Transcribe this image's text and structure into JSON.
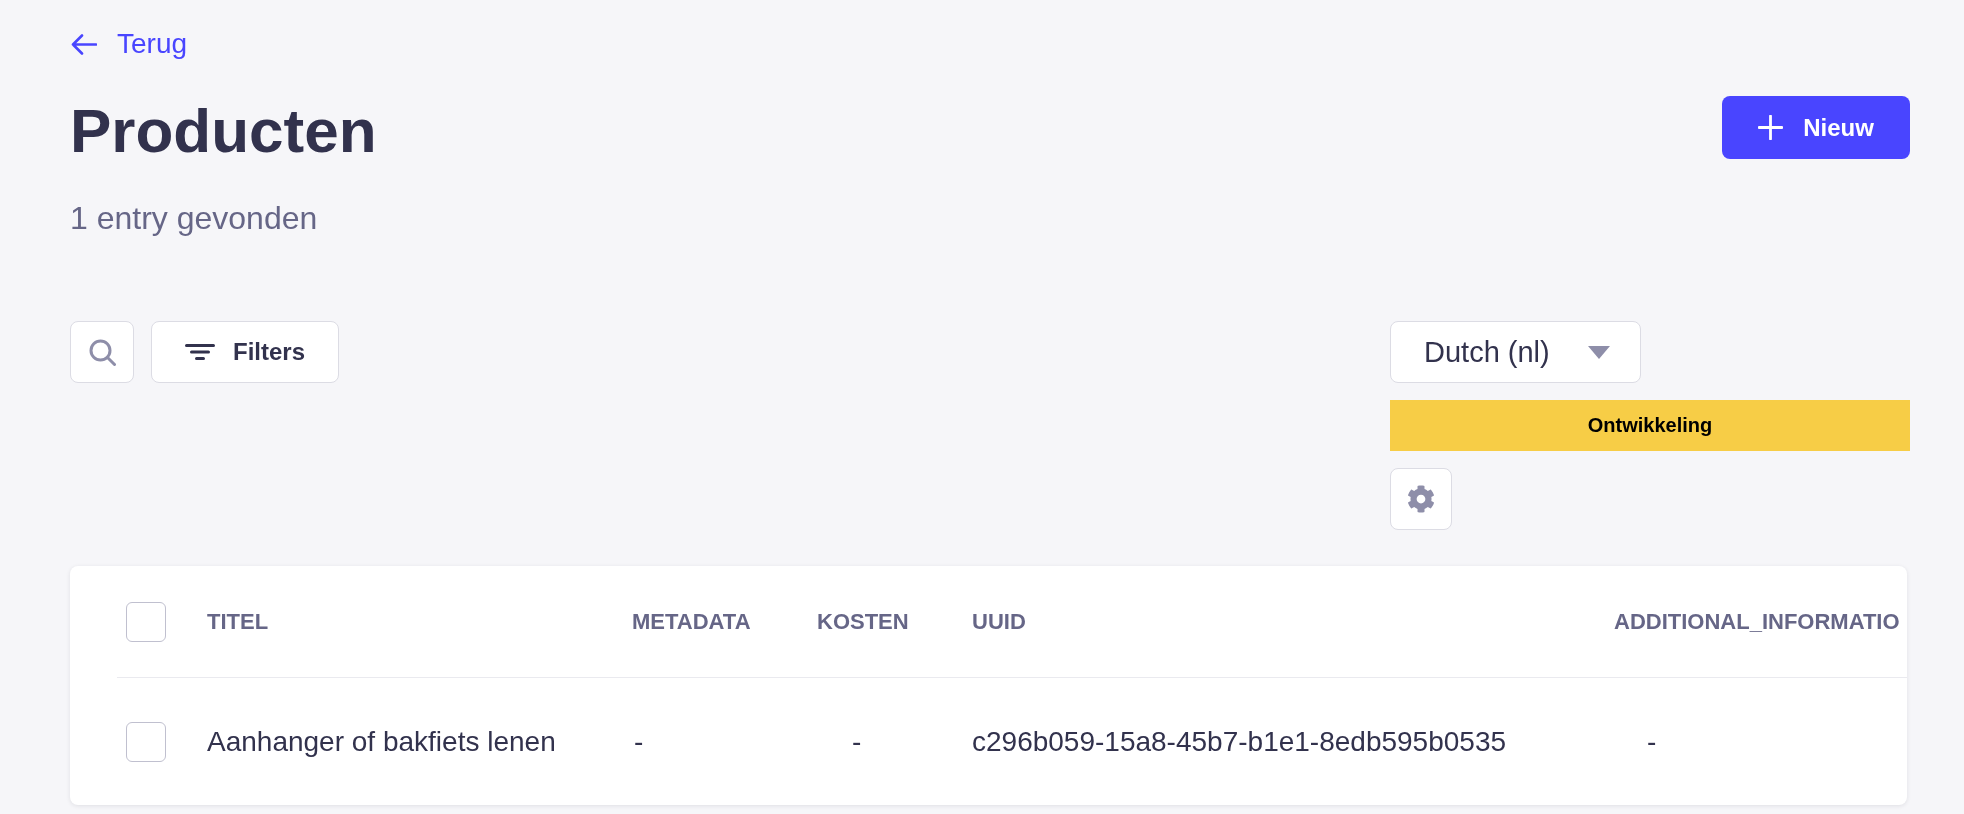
{
  "back_link": {
    "label": "Terug"
  },
  "header": {
    "title": "Producten",
    "subtitle": "1 entry gevonden",
    "new_button": {
      "label": "Nieuw"
    }
  },
  "toolbar": {
    "filters_button": {
      "label": "Filters"
    },
    "locale_select": {
      "value": "Dutch (nl)"
    },
    "environment_banner": {
      "label": "Ontwikkeling"
    }
  },
  "table": {
    "select_all": {
      "checked": false
    },
    "columns": [
      "TITEL",
      "METADATA",
      "KOSTEN",
      "UUID",
      "ADDITIONAL_INFORMATIO"
    ],
    "rows": [
      {
        "checked": false,
        "cells": [
          "Aanhanger of bakfiets lenen",
          "-",
          "-",
          "c296b059-15a8-45b7-b1e1-8edb595b0535",
          "-"
        ]
      }
    ]
  }
}
